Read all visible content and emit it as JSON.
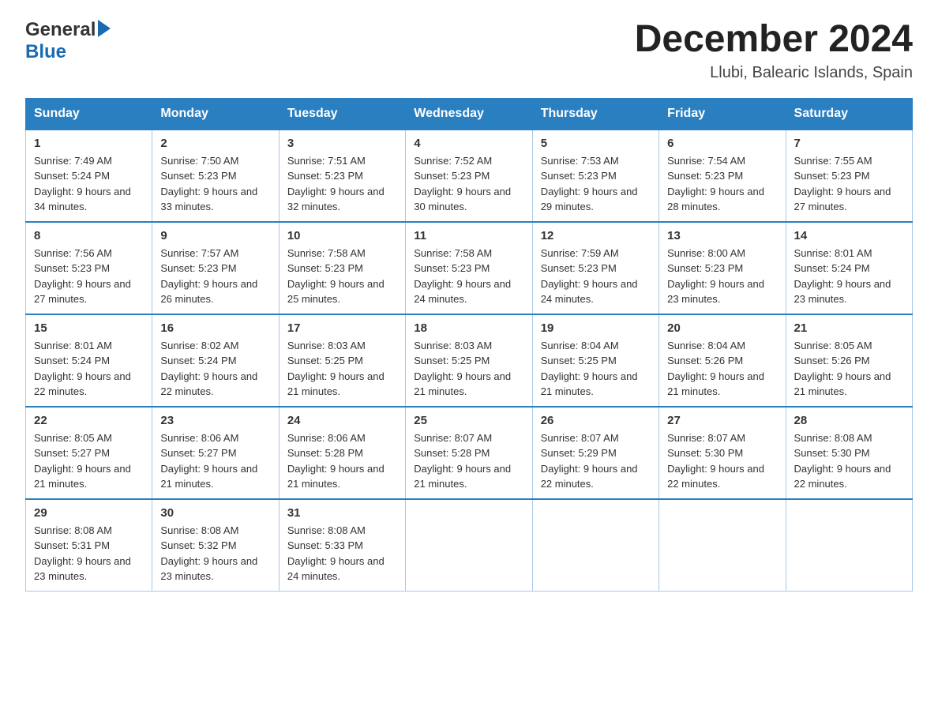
{
  "header": {
    "logo_general": "General",
    "logo_blue": "Blue",
    "month_title": "December 2024",
    "location": "Llubi, Balearic Islands, Spain"
  },
  "days_of_week": [
    "Sunday",
    "Monday",
    "Tuesday",
    "Wednesday",
    "Thursday",
    "Friday",
    "Saturday"
  ],
  "weeks": [
    [
      {
        "day": "1",
        "sunrise": "7:49 AM",
        "sunset": "5:24 PM",
        "daylight": "9 hours and 34 minutes."
      },
      {
        "day": "2",
        "sunrise": "7:50 AM",
        "sunset": "5:23 PM",
        "daylight": "9 hours and 33 minutes."
      },
      {
        "day": "3",
        "sunrise": "7:51 AM",
        "sunset": "5:23 PM",
        "daylight": "9 hours and 32 minutes."
      },
      {
        "day": "4",
        "sunrise": "7:52 AM",
        "sunset": "5:23 PM",
        "daylight": "9 hours and 30 minutes."
      },
      {
        "day": "5",
        "sunrise": "7:53 AM",
        "sunset": "5:23 PM",
        "daylight": "9 hours and 29 minutes."
      },
      {
        "day": "6",
        "sunrise": "7:54 AM",
        "sunset": "5:23 PM",
        "daylight": "9 hours and 28 minutes."
      },
      {
        "day": "7",
        "sunrise": "7:55 AM",
        "sunset": "5:23 PM",
        "daylight": "9 hours and 27 minutes."
      }
    ],
    [
      {
        "day": "8",
        "sunrise": "7:56 AM",
        "sunset": "5:23 PM",
        "daylight": "9 hours and 27 minutes."
      },
      {
        "day": "9",
        "sunrise": "7:57 AM",
        "sunset": "5:23 PM",
        "daylight": "9 hours and 26 minutes."
      },
      {
        "day": "10",
        "sunrise": "7:58 AM",
        "sunset": "5:23 PM",
        "daylight": "9 hours and 25 minutes."
      },
      {
        "day": "11",
        "sunrise": "7:58 AM",
        "sunset": "5:23 PM",
        "daylight": "9 hours and 24 minutes."
      },
      {
        "day": "12",
        "sunrise": "7:59 AM",
        "sunset": "5:23 PM",
        "daylight": "9 hours and 24 minutes."
      },
      {
        "day": "13",
        "sunrise": "8:00 AM",
        "sunset": "5:23 PM",
        "daylight": "9 hours and 23 minutes."
      },
      {
        "day": "14",
        "sunrise": "8:01 AM",
        "sunset": "5:24 PM",
        "daylight": "9 hours and 23 minutes."
      }
    ],
    [
      {
        "day": "15",
        "sunrise": "8:01 AM",
        "sunset": "5:24 PM",
        "daylight": "9 hours and 22 minutes."
      },
      {
        "day": "16",
        "sunrise": "8:02 AM",
        "sunset": "5:24 PM",
        "daylight": "9 hours and 22 minutes."
      },
      {
        "day": "17",
        "sunrise": "8:03 AM",
        "sunset": "5:25 PM",
        "daylight": "9 hours and 21 minutes."
      },
      {
        "day": "18",
        "sunrise": "8:03 AM",
        "sunset": "5:25 PM",
        "daylight": "9 hours and 21 minutes."
      },
      {
        "day": "19",
        "sunrise": "8:04 AM",
        "sunset": "5:25 PM",
        "daylight": "9 hours and 21 minutes."
      },
      {
        "day": "20",
        "sunrise": "8:04 AM",
        "sunset": "5:26 PM",
        "daylight": "9 hours and 21 minutes."
      },
      {
        "day": "21",
        "sunrise": "8:05 AM",
        "sunset": "5:26 PM",
        "daylight": "9 hours and 21 minutes."
      }
    ],
    [
      {
        "day": "22",
        "sunrise": "8:05 AM",
        "sunset": "5:27 PM",
        "daylight": "9 hours and 21 minutes."
      },
      {
        "day": "23",
        "sunrise": "8:06 AM",
        "sunset": "5:27 PM",
        "daylight": "9 hours and 21 minutes."
      },
      {
        "day": "24",
        "sunrise": "8:06 AM",
        "sunset": "5:28 PM",
        "daylight": "9 hours and 21 minutes."
      },
      {
        "day": "25",
        "sunrise": "8:07 AM",
        "sunset": "5:28 PM",
        "daylight": "9 hours and 21 minutes."
      },
      {
        "day": "26",
        "sunrise": "8:07 AM",
        "sunset": "5:29 PM",
        "daylight": "9 hours and 22 minutes."
      },
      {
        "day": "27",
        "sunrise": "8:07 AM",
        "sunset": "5:30 PM",
        "daylight": "9 hours and 22 minutes."
      },
      {
        "day": "28",
        "sunrise": "8:08 AM",
        "sunset": "5:30 PM",
        "daylight": "9 hours and 22 minutes."
      }
    ],
    [
      {
        "day": "29",
        "sunrise": "8:08 AM",
        "sunset": "5:31 PM",
        "daylight": "9 hours and 23 minutes."
      },
      {
        "day": "30",
        "sunrise": "8:08 AM",
        "sunset": "5:32 PM",
        "daylight": "9 hours and 23 minutes."
      },
      {
        "day": "31",
        "sunrise": "8:08 AM",
        "sunset": "5:33 PM",
        "daylight": "9 hours and 24 minutes."
      },
      null,
      null,
      null,
      null
    ]
  ],
  "labels": {
    "sunrise_prefix": "Sunrise: ",
    "sunset_prefix": "Sunset: ",
    "daylight_prefix": "Daylight: "
  }
}
